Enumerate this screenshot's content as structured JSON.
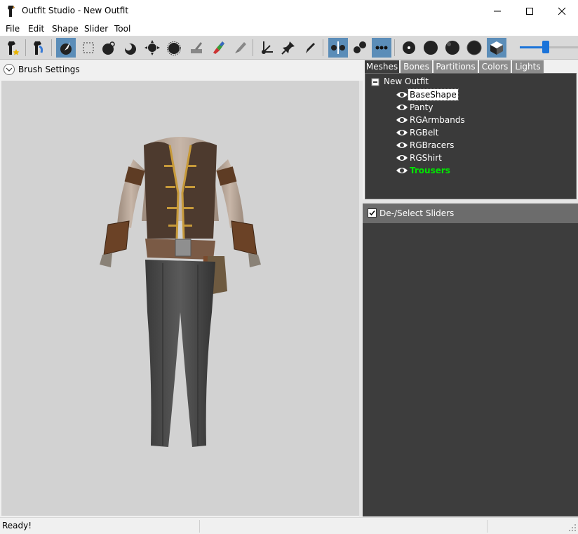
{
  "window": {
    "title": "Outfit Studio - New Outfit"
  },
  "menu": [
    "File",
    "Edit",
    "Shape",
    "Slider",
    "Tool"
  ],
  "toolbar": {
    "slider_value": 0.45
  },
  "brush_settings": {
    "label": "Brush Settings"
  },
  "tabs": [
    "Meshes",
    "Bones",
    "Partitions",
    "Colors",
    "Lights"
  ],
  "mesh_tree": {
    "root": "New Outfit",
    "items": [
      "BaseShape",
      "Panty",
      "RGArmbands",
      "RGBelt",
      "RGBracers",
      "RGShirt",
      "Trousers"
    ],
    "selected": "BaseShape",
    "active": "Trousers"
  },
  "sliders": {
    "select_label": "De-/Select Sliders"
  },
  "status": {
    "text": "Ready!"
  },
  "colors": {
    "accent": "#5b8db8",
    "slider": "#1a73d9",
    "active_mesh": "#00e600",
    "dark_panel": "#3d3d3d"
  }
}
